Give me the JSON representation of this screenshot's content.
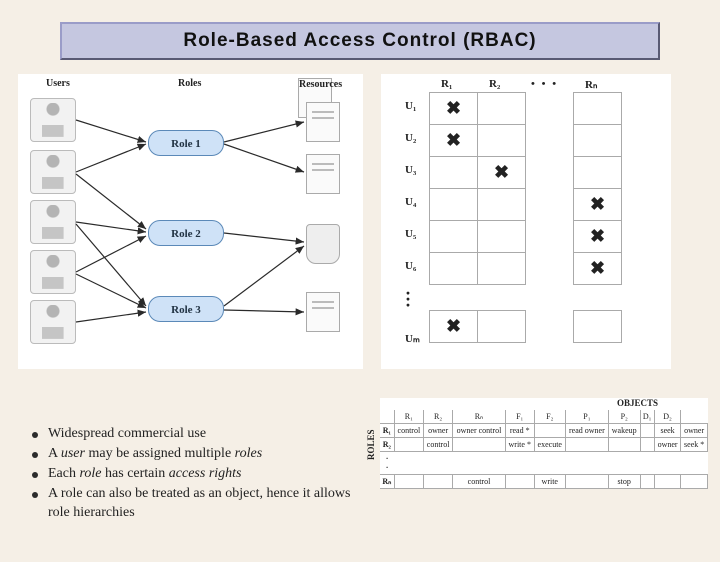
{
  "title": "Role-Based Access Control (RBAC)",
  "left": {
    "heads": {
      "users": "Users",
      "roles": "Roles",
      "resources": "Resources"
    },
    "roles": [
      "Role 1",
      "Role 2",
      "Role 3"
    ]
  },
  "grid": {
    "col_heads": [
      "R₁",
      "R₂",
      "• • •",
      "Rₙ"
    ],
    "row_heads": [
      "U₁",
      "U₂",
      "U₃",
      "U₄",
      "U₅",
      "U₆",
      "Uₘ"
    ],
    "marks": [
      [
        true,
        false,
        false,
        false
      ],
      [
        true,
        false,
        false,
        false
      ],
      [
        false,
        true,
        false,
        false
      ],
      [
        false,
        false,
        false,
        true
      ],
      [
        false,
        false,
        false,
        true
      ],
      [
        false,
        false,
        false,
        true
      ],
      [
        true,
        false,
        false,
        false
      ]
    ]
  },
  "bullets": [
    "Widespread commercial use",
    "A <i>user</i> may be assigned multiple <i>roles</i>",
    "Each <i>role</i> has certain <i>access rights</i>",
    "A role can also be treated as an object, hence it allows role hierarchies"
  ],
  "objects": {
    "label_objects": "OBJECTS",
    "label_roles": "ROLES",
    "cols": [
      "R₁",
      "R₂",
      "Rₙ",
      "F₁",
      "F₂",
      "P₁",
      "P₂",
      "D₁",
      "D₂"
    ],
    "rows": [
      {
        "h": "R₁",
        "c": [
          "control",
          "owner",
          "owner control",
          "read *",
          "",
          "read owner",
          "wakeup",
          "",
          "seek",
          "owner"
        ]
      },
      {
        "h": "R₂",
        "c": [
          "",
          "control",
          "",
          "write *",
          "execute",
          "",
          "",
          "",
          "owner",
          "seek *"
        ]
      },
      {
        "h": "Rₙ",
        "c": [
          "",
          "",
          "control",
          "",
          "write",
          "",
          "stop",
          "",
          "",
          ""
        ]
      }
    ]
  }
}
